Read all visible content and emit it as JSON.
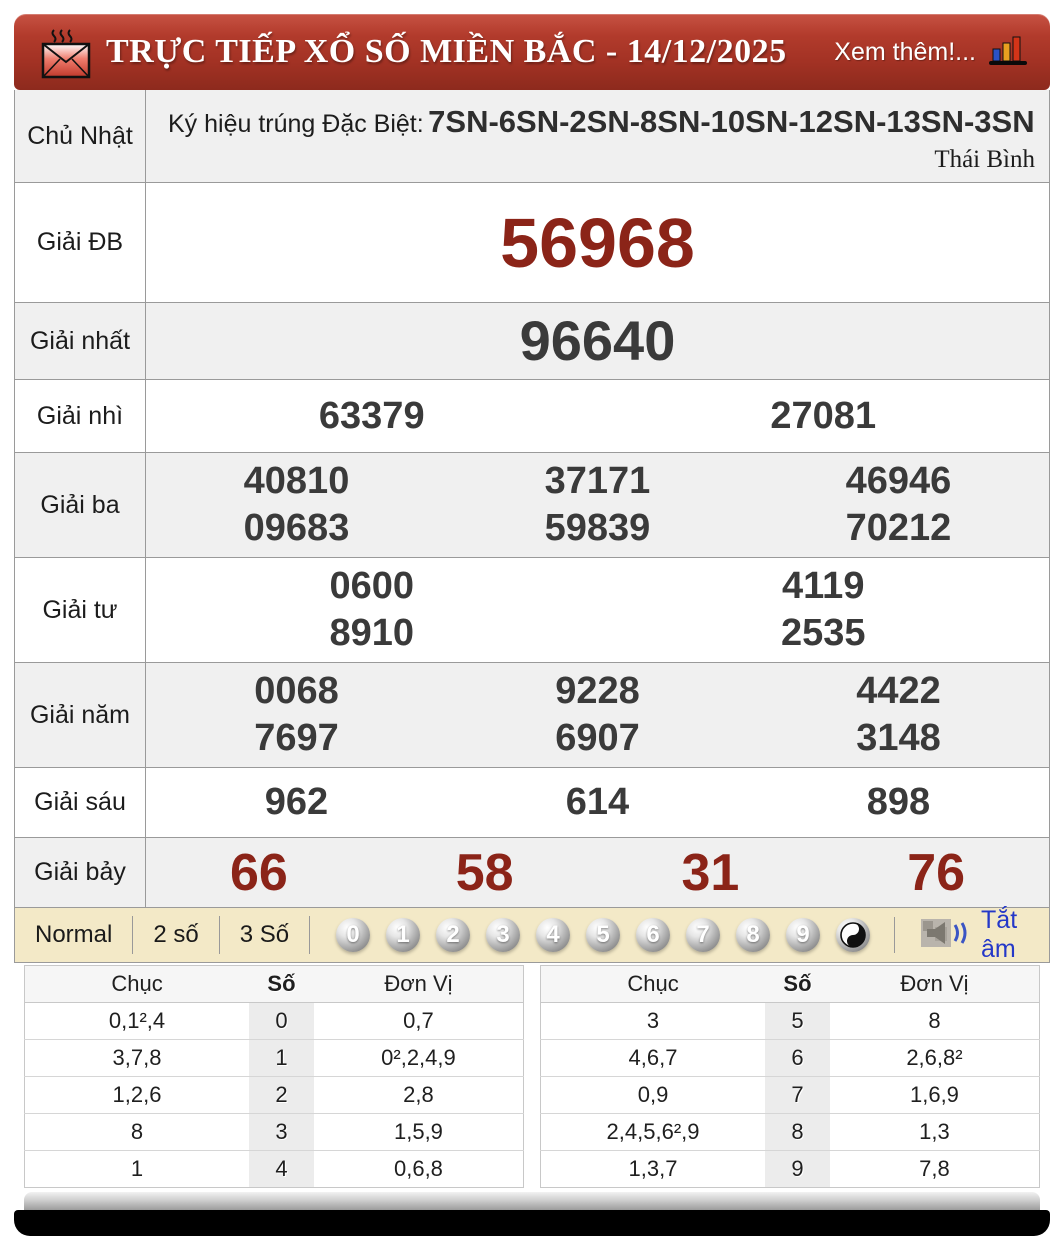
{
  "header": {
    "title": "TRỰC TIẾP XỔ SỐ MIỀN BẮC - 14/12/2025",
    "more": "Xem thêm!..."
  },
  "board": {
    "day": "Chủ Nhật",
    "sign_label": "Ký hiệu trúng Đặc Biệt:",
    "sign_codes": "7SN-6SN-2SN-8SN-10SN-12SN-13SN-3SN",
    "province": "Thái Bình",
    "prizes": [
      {
        "label": "Giải ĐB",
        "kind": "special",
        "cols": 1,
        "values": [
          "56968"
        ]
      },
      {
        "label": "Giải nhất",
        "kind": "first",
        "cols": 1,
        "values": [
          "96640"
        ]
      },
      {
        "label": "Giải nhì",
        "kind": "normal2",
        "cols": 2,
        "values": [
          "63379",
          "27081"
        ]
      },
      {
        "label": "Giải ba",
        "kind": "normal",
        "cols": 3,
        "values": [
          "40810",
          "37171",
          "46946",
          "09683",
          "59839",
          "70212"
        ]
      },
      {
        "label": "Giải tư",
        "kind": "normal",
        "cols": 2,
        "values": [
          "0600",
          "4119",
          "8910",
          "2535"
        ]
      },
      {
        "label": "Giải năm",
        "kind": "normal",
        "cols": 3,
        "values": [
          "0068",
          "9228",
          "4422",
          "7697",
          "6907",
          "3148"
        ]
      },
      {
        "label": "Giải sáu",
        "kind": "six",
        "cols": 3,
        "values": [
          "962",
          "614",
          "898"
        ]
      },
      {
        "label": "Giải bảy",
        "kind": "seven",
        "cols": 4,
        "values": [
          "66",
          "58",
          "31",
          "76"
        ]
      }
    ]
  },
  "controls": {
    "modes": [
      "Normal",
      "2 số",
      "3 Số"
    ],
    "digit_balls": [
      "0",
      "1",
      "2",
      "3",
      "4",
      "5",
      "6",
      "7",
      "8",
      "9"
    ],
    "mute_label": "Tắt âm"
  },
  "stats": {
    "headers": [
      "Chục",
      "Số",
      "Đơn Vị"
    ],
    "tables": [
      {
        "rows": [
          [
            "0,1²,4",
            "0",
            "0,7"
          ],
          [
            "3,7,8",
            "1",
            "0²,2,4,9"
          ],
          [
            "1,2,6",
            "2",
            "2,8"
          ],
          [
            "8",
            "3",
            "1,5,9"
          ],
          [
            "1",
            "4",
            "0,6,8"
          ]
        ]
      },
      {
        "rows": [
          [
            "3",
            "5",
            "8"
          ],
          [
            "4,6,7",
            "6",
            "2,6,8²"
          ],
          [
            "0,9",
            "7",
            "1,6,9"
          ],
          [
            "2,4,5,6²,9",
            "8",
            "1,3"
          ],
          [
            "1,3,7",
            "9",
            "7,8"
          ]
        ]
      }
    ]
  },
  "colors": {
    "header_red": "#a33224",
    "prize_maroon": "#8b2418",
    "number_gray": "#3a3a3a",
    "controls_bg": "#f3e9c7",
    "mute_blue": "#2438c8"
  }
}
